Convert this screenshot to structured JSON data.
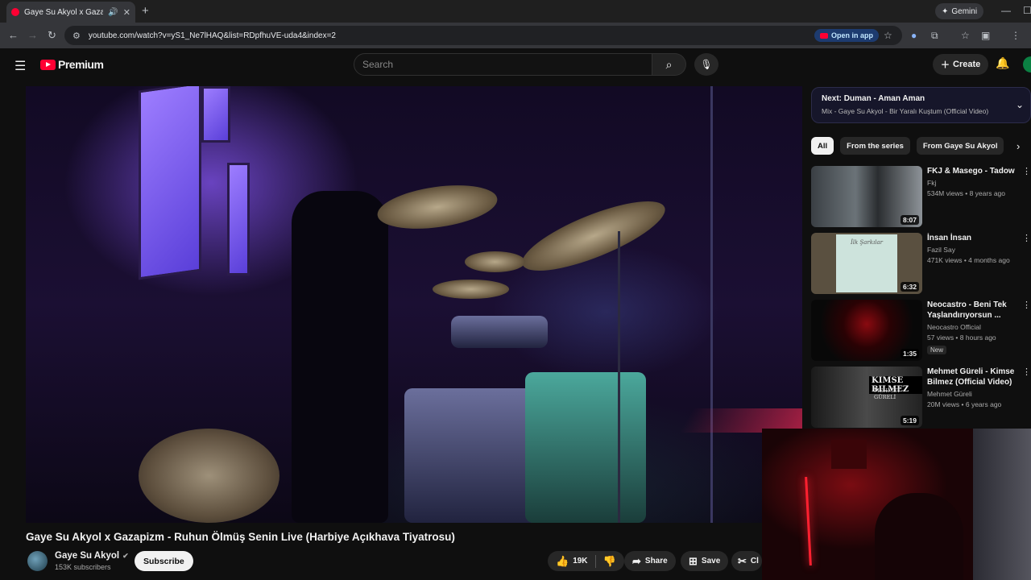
{
  "browser": {
    "tab_title": "Gaye Su Akyol x Gazapizm",
    "tab_speaker": "🔊",
    "tab_close": "✕",
    "new_tab": "+",
    "gemini_label": "Gemini",
    "url": "youtube.com/watch?v=yS1_Ne7lHAQ&list=RDpfhuVE-uda4&index=2",
    "open_in_app": "Open in app"
  },
  "youtube": {
    "logo_text": "Premium",
    "search_placeholder": "Search",
    "create_label": "Create"
  },
  "video": {
    "title": "Gaye Su Akyol x Gazapizm - Ruhun Ölmüş Senin Live (Harbiye Açıkhava Tiyatrosu)",
    "channel": "Gaye Su Akyol",
    "subscribers": "153K subscribers",
    "subscribe_label": "Subscribe",
    "likes": "19K",
    "share_label": "Share",
    "save_label": "Save",
    "clip_label": "Cl"
  },
  "up_next": {
    "next_label": "Next: Duman - Aman Aman",
    "mix_label": "Mix - Gaye Su Akyol - Bir Yaralı Kuştum (Official Video)"
  },
  "chips": [
    "All",
    "From the series",
    "From Gaye Su Akyol"
  ],
  "recommendations": [
    {
      "title": "FKJ & Masego - Tadow",
      "channel": "Fkj",
      "meta": "534M views • 8 years ago",
      "duration": "8:07",
      "new": ""
    },
    {
      "title": "İnsan İnsan",
      "channel": "Fazil Say",
      "meta": "471K views • 4 months ago",
      "duration": "6:32",
      "new": ""
    },
    {
      "title": "Neocastro - Beni Tek Yaşlandırıyorsun ...",
      "channel": "Neocastro Official",
      "meta": "57 views • 8 hours ago",
      "duration": "1:35",
      "new": "New"
    },
    {
      "title": "Mehmet Güreli - Kimse Bilmez (Official Video)",
      "channel": "Mehmet Güreli",
      "meta": "20M views • 6 years ago",
      "duration": "5:19",
      "new": ""
    }
  ],
  "thumb_texts": {
    "album": "İlk Şarkılar",
    "kimse": "KIMSE BILMEZ",
    "kimse_sub": "MEHMET GÜRELİ"
  },
  "colors": {
    "yt_red": "#ff0033",
    "bg": "#0f0f0f",
    "chip": "#272727"
  }
}
